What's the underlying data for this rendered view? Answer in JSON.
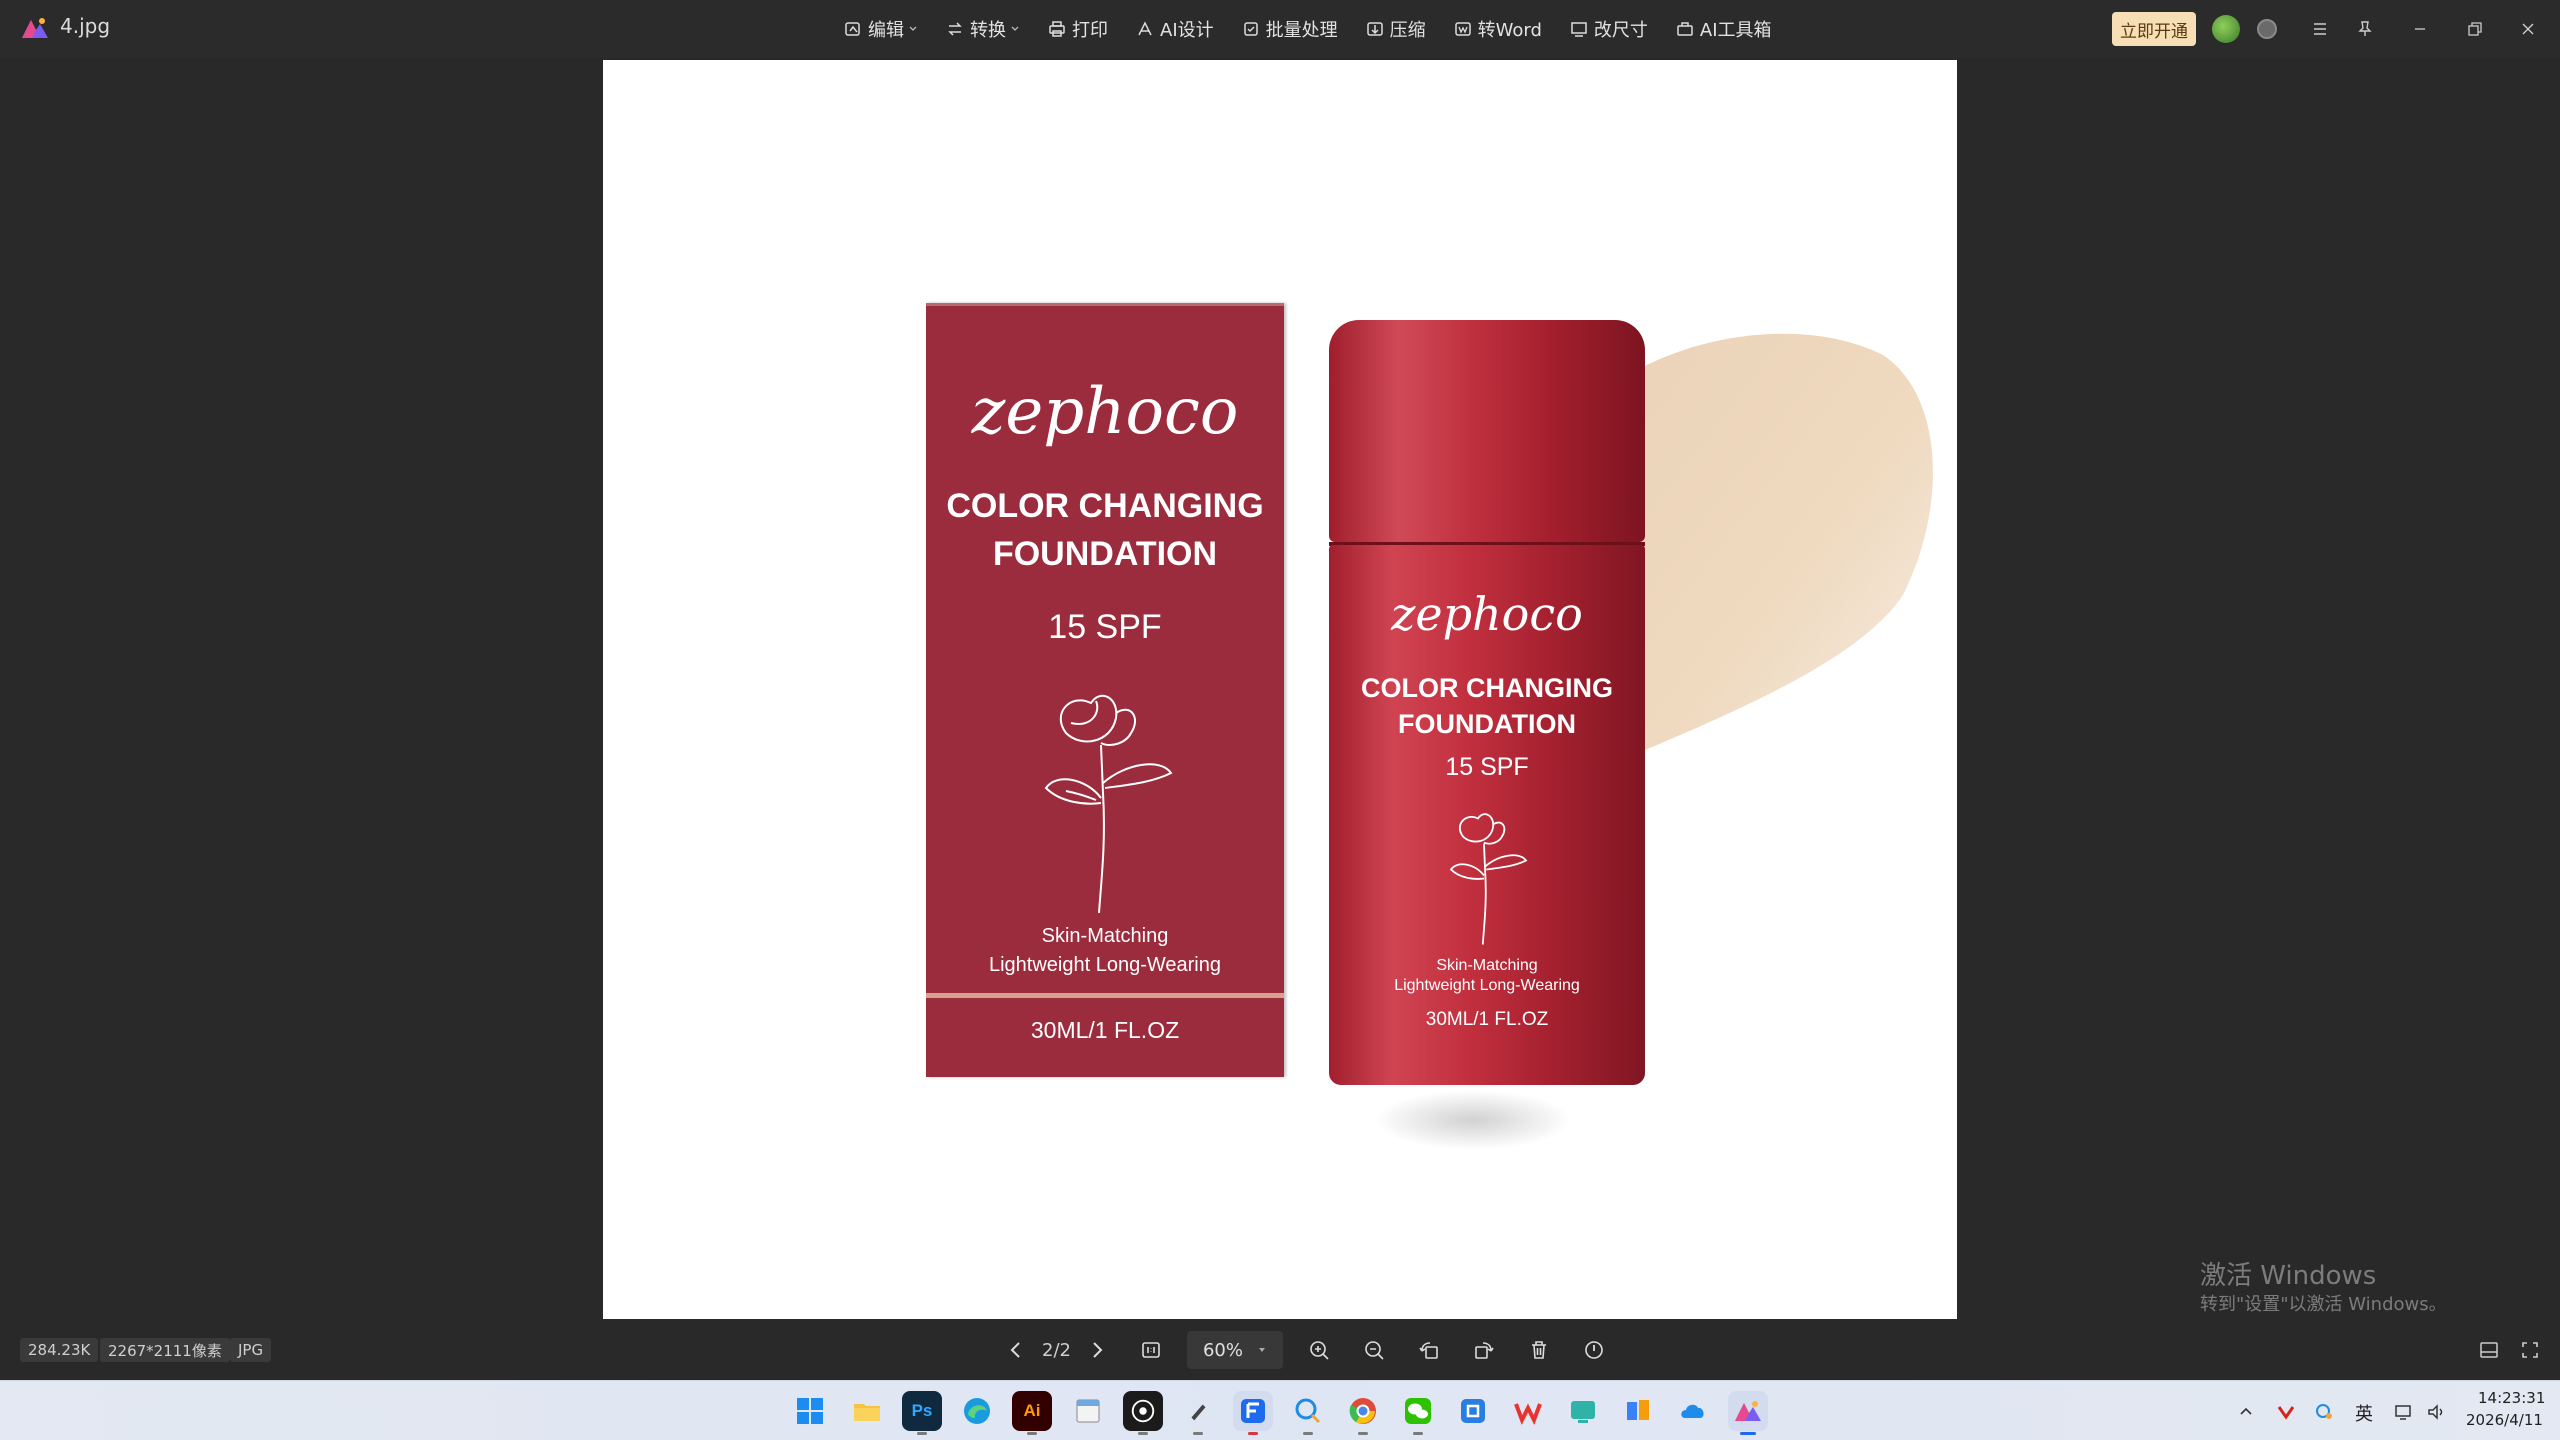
{
  "titlebar": {
    "filename": "4.jpg",
    "vip_button": "立即开通"
  },
  "toolbar": {
    "items": [
      {
        "label": "编辑",
        "icon": "edit-icon",
        "dropdown": true
      },
      {
        "label": "转换",
        "icon": "convert-icon",
        "dropdown": true
      },
      {
        "label": "打印",
        "icon": "print-icon",
        "dropdown": false
      },
      {
        "label": "AI设计",
        "icon": "ai-design-icon",
        "dropdown": false
      },
      {
        "label": "批量处理",
        "icon": "batch-icon",
        "dropdown": false
      },
      {
        "label": "压缩",
        "icon": "compress-icon",
        "dropdown": false
      },
      {
        "label": "转Word",
        "icon": "word-icon",
        "dropdown": false
      },
      {
        "label": "改尺寸",
        "icon": "resize-icon",
        "dropdown": false
      },
      {
        "label": "AI工具箱",
        "icon": "ai-toolbox-icon",
        "dropdown": false
      }
    ]
  },
  "image": {
    "box": {
      "brand": "zephoco",
      "title_line1": "COLOR CHANGING",
      "title_line2": "FOUNDATION",
      "spf": "15 SPF",
      "tagline1": "Skin-Matching",
      "tagline2": "Lightweight Long-Wearing",
      "volume": "30ML/1 FL.OZ"
    },
    "bottle": {
      "brand": "zephoco",
      "title_line1": "COLOR CHANGING",
      "title_line2": "FOUNDATION",
      "spf": "15 SPF",
      "tagline1": "Skin-Matching",
      "tagline2": "Lightweight Long-Wearing",
      "volume": "30ML/1 FL.OZ"
    }
  },
  "statusbar": {
    "file_size": "284.23K",
    "dimensions": "2267*2111像素",
    "format": "JPG",
    "page": "2/2",
    "zoom": "60%"
  },
  "watermark": {
    "title": "激活 Windows",
    "subtitle": "转到\"设置\"以激活 Windows。"
  },
  "taskbar": {
    "apps": [
      "start",
      "file-explorer",
      "photoshop",
      "edge",
      "illustrator",
      "notepad",
      "obs",
      "pen-tool",
      "feishu",
      "search-app",
      "chrome",
      "wechat",
      "app-store",
      "wps",
      "meeting",
      "file-manager",
      "onedrive",
      "image-viewer"
    ],
    "input_method": "英",
    "time": "14:23:31",
    "date": "2026/4/11"
  },
  "colors": {
    "box_red": "#9b2c3d",
    "bottle_red": "#c0303f",
    "vip_bg": "#f6dfb4",
    "viewer_bg": "#292929"
  }
}
